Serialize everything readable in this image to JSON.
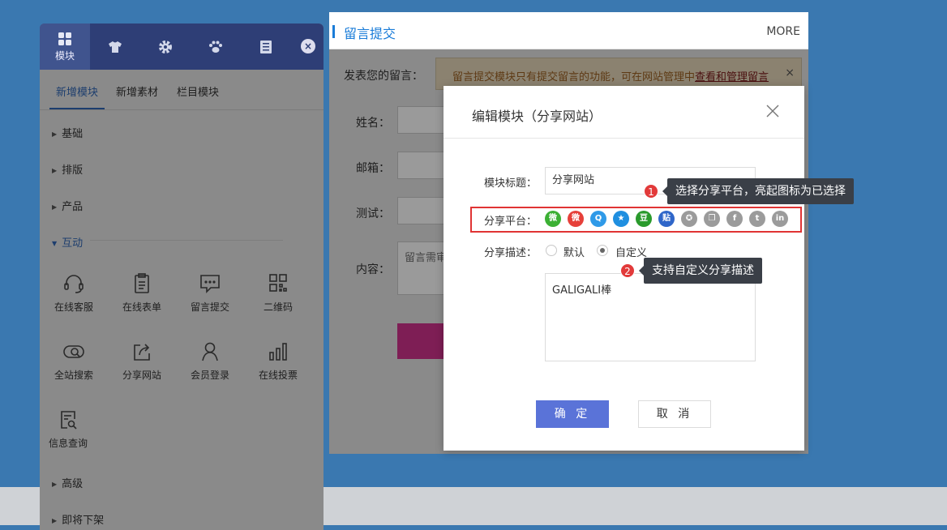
{
  "bg_panel": {
    "title": "留言提交",
    "more": "MORE",
    "prompt": "发表您的留言：",
    "notice_text": "留言提交模块只有提交留言的功能，可在网站管理中",
    "notice_link": "查看和管理留言",
    "notice_close": "×",
    "fields": [
      {
        "label": "姓名："
      },
      {
        "label": "邮箱："
      },
      {
        "label": "测试："
      },
      {
        "label": "内容："
      }
    ],
    "textarea_placeholder": "留言需审"
  },
  "panel": {
    "tabs": [
      {
        "label": "模块",
        "icon": "grid-icon"
      },
      {
        "label": "",
        "icon": "shirt-icon"
      },
      {
        "label": "",
        "icon": "gear-icon"
      },
      {
        "label": "",
        "icon": "paw-icon"
      },
      {
        "label": "",
        "icon": "book-icon"
      }
    ],
    "close": "×",
    "subtabs": [
      "新增模块",
      "新增素材",
      "栏目模块"
    ],
    "categories": [
      "基础",
      "排版",
      "产品",
      "互动",
      "高级",
      "即将下架"
    ],
    "modules": [
      {
        "label": "在线客服",
        "icon": "headset-icon"
      },
      {
        "label": "在线表单",
        "icon": "clipboard-icon"
      },
      {
        "label": "留言提交",
        "icon": "message-icon"
      },
      {
        "label": "二维码",
        "icon": "qrcode-icon"
      },
      {
        "label": "全站搜索",
        "icon": "search-icon"
      },
      {
        "label": "分享网站",
        "icon": "share-icon"
      },
      {
        "label": "会员登录",
        "icon": "user-icon"
      },
      {
        "label": "在线投票",
        "icon": "bar-chart-icon"
      },
      {
        "label": "信息查询",
        "icon": "doc-search-icon"
      }
    ]
  },
  "modal": {
    "title": "编辑模块（分享网站）",
    "title_label": "模块标题：",
    "title_value": "分享网站",
    "platform_label": "分享平台：",
    "platforms": [
      {
        "name": "wechat-icon",
        "glyph": "微",
        "color": "#3cb034"
      },
      {
        "name": "weibo-icon",
        "glyph": "微",
        "color": "#e6403a"
      },
      {
        "name": "qq-icon",
        "glyph": "Q",
        "color": "#2f9ae8"
      },
      {
        "name": "qzone-icon",
        "glyph": "★",
        "color": "#1f8fe0"
      },
      {
        "name": "douban-icon",
        "glyph": "豆",
        "color": "#2a9a2c"
      },
      {
        "name": "tieba-icon",
        "glyph": "贴",
        "color": "#2f66c9"
      },
      {
        "name": "star-icon",
        "glyph": "✪",
        "color": "#9b9b9b"
      },
      {
        "name": "copy-icon",
        "glyph": "❐",
        "color": "#9b9b9b"
      },
      {
        "name": "facebook-icon",
        "glyph": "f",
        "color": "#9b9b9b"
      },
      {
        "name": "tumblr-icon",
        "glyph": "t",
        "color": "#9b9b9b"
      },
      {
        "name": "linkedin-icon",
        "glyph": "in",
        "color": "#9b9b9b"
      }
    ],
    "desc_label": "分享描述：",
    "radio_default": "默认",
    "radio_custom": "自定义",
    "desc_value": "GALIGALI棒",
    "ok": "确 定",
    "cancel": "取 消"
  },
  "tips": [
    {
      "badge": "1",
      "text": "选择分享平台，亮起图标为已选择"
    },
    {
      "badge": "2",
      "text": "支持自定义分享描述"
    }
  ]
}
